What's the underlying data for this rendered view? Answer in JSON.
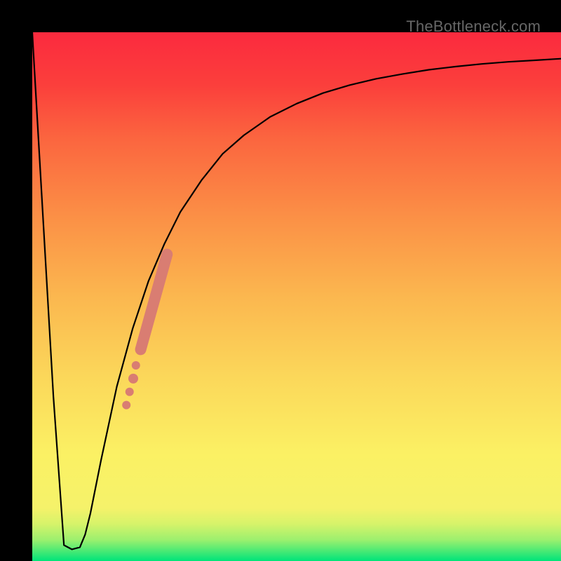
{
  "watermark": "TheBottleneck.com",
  "chart_data": {
    "type": "line",
    "title": "",
    "xlabel": "",
    "ylabel": "",
    "xlim": [
      0,
      1
    ],
    "ylim": [
      0,
      1
    ],
    "grid": false,
    "background_gradient": {
      "stops": [
        {
          "y": 0.0,
          "color": "#00e47a"
        },
        {
          "y": 0.04,
          "color": "#9cf06e"
        },
        {
          "y": 0.07,
          "color": "#d6f36a"
        },
        {
          "y": 0.1,
          "color": "#f5f26a"
        },
        {
          "y": 0.2,
          "color": "#fbf164"
        },
        {
          "y": 0.35,
          "color": "#fbd75a"
        },
        {
          "y": 0.5,
          "color": "#fbb74f"
        },
        {
          "y": 0.65,
          "color": "#fb9046"
        },
        {
          "y": 0.8,
          "color": "#fb653f"
        },
        {
          "y": 0.9,
          "color": "#fb3f3c"
        },
        {
          "y": 1.0,
          "color": "#fb2a3e"
        }
      ]
    },
    "series": [
      {
        "name": "curve",
        "color": "#000000",
        "width": 2.2,
        "x": [
          0.0,
          0.04,
          0.06,
          0.075,
          0.09,
          0.1,
          0.11,
          0.13,
          0.16,
          0.19,
          0.22,
          0.25,
          0.28,
          0.32,
          0.36,
          0.4,
          0.45,
          0.5,
          0.55,
          0.6,
          0.65,
          0.7,
          0.75,
          0.8,
          0.85,
          0.9,
          0.95,
          1.0
        ],
        "y": [
          1.0,
          0.31,
          0.03,
          0.022,
          0.026,
          0.05,
          0.09,
          0.19,
          0.33,
          0.44,
          0.53,
          0.6,
          0.66,
          0.72,
          0.77,
          0.805,
          0.84,
          0.865,
          0.885,
          0.9,
          0.912,
          0.921,
          0.929,
          0.935,
          0.94,
          0.944,
          0.947,
          0.95
        ]
      }
    ],
    "marker_band": {
      "name": "highlight-dots",
      "color": "#d97d72",
      "points": [
        {
          "x": 0.178,
          "y": 0.295,
          "r": 6
        },
        {
          "x": 0.184,
          "y": 0.32,
          "r": 6
        },
        {
          "x": 0.191,
          "y": 0.345,
          "r": 7
        },
        {
          "x": 0.196,
          "y": 0.37,
          "r": 6
        }
      ],
      "segment": {
        "x0": 0.205,
        "y0": 0.4,
        "x1": 0.255,
        "y1": 0.58,
        "width": 16
      }
    }
  }
}
